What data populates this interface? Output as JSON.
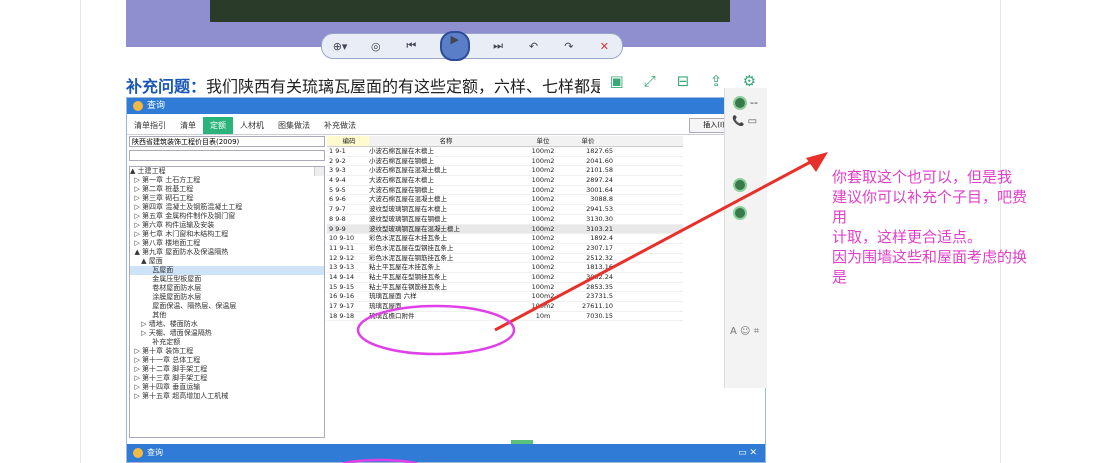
{
  "video": {
    "controls": [
      "⊕▾",
      "◎",
      "⏮",
      "▶",
      "⏭",
      "↶",
      "↷",
      "✕"
    ]
  },
  "heading": {
    "label": "补充问题：",
    "text": "我们陕西有关琉璃瓦屋面的有这些定额，六样、七样都是"
  },
  "float_toolbar": [
    "▣",
    "⤢",
    "⊟",
    "⇪",
    "⚙"
  ],
  "app": {
    "title": "查询",
    "tabs": [
      "清单指引",
      "清单",
      "定额",
      "人材机",
      "图集做法",
      "补充做法"
    ],
    "active_tab": 2,
    "insert_button": "插入(I)",
    "standard_select": "陕西省建筑装饰工程价目表(2009)",
    "tree": [
      "▲ 土建工程",
      "  ▷ 第一章 土石方工程",
      "  ▷ 第二章 桩基工程",
      "  ▷ 第三章 砌石工程",
      "  ▷ 第四章 混凝土及钢筋混凝土工程",
      "  ▷ 第五章 金属构件制作及钢门窗",
      "  ▷ 第六章 构件运输及安装",
      "  ▷ 第七章 木门窗和木结构工程",
      "  ▷ 第八章 楼地面工程",
      "  ▲ 第九章 屋面防水及保温隔热",
      "     ▲ 屋面",
      "          瓦屋面",
      "          金属压型板屋面",
      "          卷材屋面防水层",
      "          涂膜屋面防水层",
      "          屋面保温、隔热层、保温层",
      "          其他",
      "     ▷ 墙地、楼面防水",
      "     ▷ 天棚、墙面保温隔热",
      "          补充定额",
      "  ▷ 第十章 装饰工程",
      "  ▷ 第十一章 总体工程",
      "  ▷ 第十二章 脚手架工程",
      "  ▷ 第十三章 脚手架工程",
      "  ▷ 第十四章 垂直运输",
      "  ▷ 第十五章 超高增加人工机械"
    ],
    "tree_selected": 11,
    "columns": [
      "编码",
      "名称",
      "单位",
      "单价"
    ],
    "rows": [
      [
        "1  9-1",
        "小波石棉瓦屋在木檩上",
        "100m2",
        "1827.65"
      ],
      [
        "2  9-2",
        "小波石棉瓦屋在钢檩上",
        "100m2",
        "2041.60"
      ],
      [
        "3  9-3",
        "小波石棉瓦屋在混凝土檩上",
        "100m2",
        "2101.58"
      ],
      [
        "4  9-4",
        "大波石棉瓦屋在木檩上",
        "100m2",
        "2897.24"
      ],
      [
        "5  9-5",
        "大波石棉瓦屋在钢檩上",
        "100m2",
        "3001.64"
      ],
      [
        "6  9-6",
        "大波石棉瓦屋在混凝土檩上",
        "100m2",
        "3088.8"
      ],
      [
        "7  9-7",
        "波纹型玻璃钢瓦屋在木檩上",
        "100m2",
        "2941.53"
      ],
      [
        "8  9-8",
        "波纹型玻璃钢瓦屋在钢檩上",
        "100m2",
        "3130.30"
      ],
      [
        "9  9-9",
        "波纹型玻璃钢瓦屋在混凝土檩上",
        "100m2",
        "3103.21"
      ],
      [
        "10 9-10",
        "彩色水泥瓦屋在木挂瓦条上",
        "100m2",
        "1892.4"
      ],
      [
        "11 9-11",
        "彩色水泥瓦屋在型钢挂瓦条上",
        "100m2",
        "2307.17"
      ],
      [
        "12 9-12",
        "彩色水泥瓦屋在钢筋挂瓦条上",
        "100m2",
        "2512.32"
      ],
      [
        "13 9-13",
        "粘土平瓦屋在木挂瓦条上",
        "100m2",
        "1813.16"
      ],
      [
        "14 9-14",
        "粘土平瓦屋在型钢挂瓦条上",
        "100m2",
        "3082.24"
      ],
      [
        "15 9-15",
        "粘土平瓦屋在钢筋挂瓦条上",
        "100m2",
        "2853.35"
      ],
      [
        "16 9-16",
        "琉璃瓦屋面 六样",
        "100m2",
        "23731.5"
      ],
      [
        "17 9-17",
        "琉璃瓦屋面",
        "100m2",
        "27611.10"
      ],
      [
        "18 9-18",
        "琉璃瓦檐口附件",
        "10m",
        "7030.15"
      ]
    ],
    "highlight_row": 8,
    "footer_title": "查询",
    "footer_controls": "▭ ✕"
  },
  "chat": {
    "top_text": "--",
    "icons": "📞 ▭",
    "bottom_icons": "A ☺ ⌗"
  },
  "annotation": {
    "lines": [
      "你套取这个也可以，但是我",
      "建议你可以补充个子目，吧费",
      "用",
      "计取，这样更合适点。",
      "因为围墙这些和屋面考虑的换",
      "是",
      "一…"
    ],
    "color": "#e040c8",
    "arrow_color": "#e8302a"
  }
}
